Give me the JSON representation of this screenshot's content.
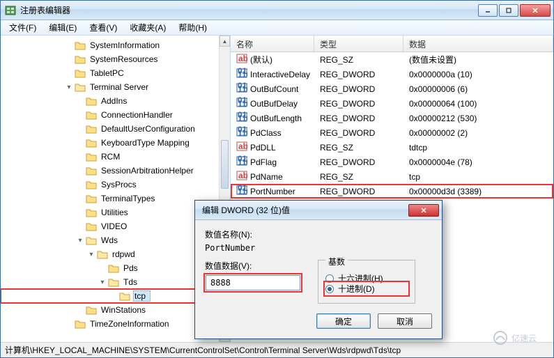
{
  "window": {
    "title": "注册表编辑器"
  },
  "menu": {
    "file": "文件(F)",
    "edit": "编辑(E)",
    "view": "查看(V)",
    "fav": "收藏夹(A)",
    "help": "帮助(H)"
  },
  "tree": [
    {
      "lvl": 0,
      "exp": "",
      "label": "SystemInformation"
    },
    {
      "lvl": 0,
      "exp": "",
      "label": "SystemResources"
    },
    {
      "lvl": 0,
      "exp": "",
      "label": "TabletPC"
    },
    {
      "lvl": 0,
      "exp": "open",
      "label": "Terminal Server"
    },
    {
      "lvl": 1,
      "exp": "",
      "label": "AddIns"
    },
    {
      "lvl": 1,
      "exp": "",
      "label": "ConnectionHandler"
    },
    {
      "lvl": 1,
      "exp": "",
      "label": "DefaultUserConfiguration"
    },
    {
      "lvl": 1,
      "exp": "",
      "label": "KeyboardType Mapping"
    },
    {
      "lvl": 1,
      "exp": "",
      "label": "RCM"
    },
    {
      "lvl": 1,
      "exp": "",
      "label": "SessionArbitrationHelper"
    },
    {
      "lvl": 1,
      "exp": "",
      "label": "SysProcs"
    },
    {
      "lvl": 1,
      "exp": "",
      "label": "TerminalTypes"
    },
    {
      "lvl": 1,
      "exp": "",
      "label": "Utilities"
    },
    {
      "lvl": 1,
      "exp": "",
      "label": "VIDEO"
    },
    {
      "lvl": 1,
      "exp": "open",
      "label": "Wds"
    },
    {
      "lvl": 2,
      "exp": "open",
      "label": "rdpwd"
    },
    {
      "lvl": 3,
      "exp": "",
      "label": "Pds"
    },
    {
      "lvl": 3,
      "exp": "open",
      "label": "Tds"
    },
    {
      "lvl": 4,
      "exp": "",
      "label": "tcp",
      "sel": true,
      "hl": true
    },
    {
      "lvl": 1,
      "exp": "",
      "label": "WinStations"
    },
    {
      "lvl": 0,
      "exp": "",
      "label": "TimeZoneInformation"
    }
  ],
  "columns": {
    "name": "名称",
    "type": "类型",
    "data": "数据"
  },
  "rows": [
    {
      "icon": "sz",
      "name": "(默认)",
      "type": "REG_SZ",
      "data": "(数值未设置)"
    },
    {
      "icon": "dw",
      "name": "InteractiveDelay",
      "type": "REG_DWORD",
      "data": "0x0000000a (10)"
    },
    {
      "icon": "dw",
      "name": "OutBufCount",
      "type": "REG_DWORD",
      "data": "0x00000006 (6)"
    },
    {
      "icon": "dw",
      "name": "OutBufDelay",
      "type": "REG_DWORD",
      "data": "0x00000064 (100)"
    },
    {
      "icon": "dw",
      "name": "OutBufLength",
      "type": "REG_DWORD",
      "data": "0x00000212 (530)"
    },
    {
      "icon": "dw",
      "name": "PdClass",
      "type": "REG_DWORD",
      "data": "0x00000002 (2)"
    },
    {
      "icon": "sz",
      "name": "PdDLL",
      "type": "REG_SZ",
      "data": "tdtcp"
    },
    {
      "icon": "dw",
      "name": "PdFlag",
      "type": "REG_DWORD",
      "data": "0x0000004e (78)"
    },
    {
      "icon": "sz",
      "name": "PdName",
      "type": "REG_SZ",
      "data": "tcp"
    },
    {
      "icon": "dw",
      "name": "PortNumber",
      "type": "REG_DWORD",
      "data": "0x00000d3d (3389)",
      "hl": true
    }
  ],
  "dialog": {
    "title": "编辑 DWORD (32 位)值",
    "name_label": "数值名称(N):",
    "name_value": "PortNumber",
    "data_label": "数值数据(V):",
    "data_value": "8888",
    "radix_label": "基数",
    "radix_hex": "十六进制(H)",
    "radix_dec": "十进制(D)",
    "ok": "确定",
    "cancel": "取消"
  },
  "statusbar": "计算机\\HKEY_LOCAL_MACHINE\\SYSTEM\\CurrentControlSet\\Control\\Terminal Server\\Wds\\rdpwd\\Tds\\tcp",
  "watermark": "亿速云"
}
